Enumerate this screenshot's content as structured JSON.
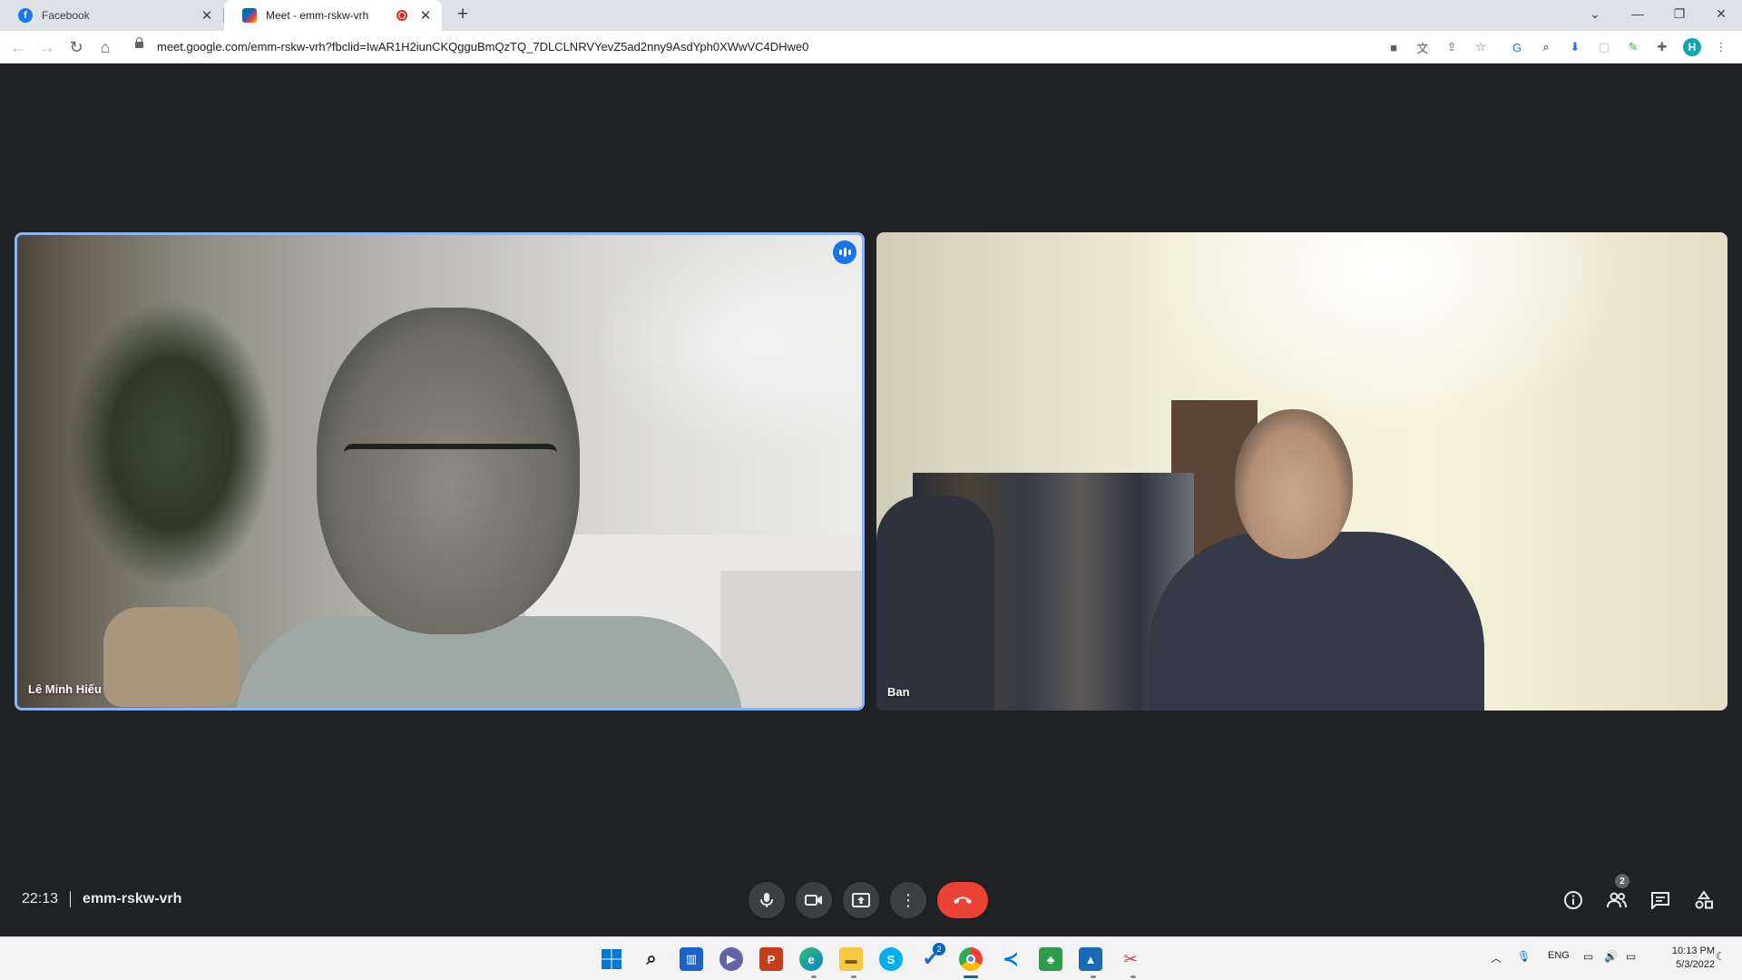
{
  "browser": {
    "tabs": [
      {
        "title": "Facebook",
        "icon": "facebook-icon",
        "active": false
      },
      {
        "title": "Meet - emm-rskw-vrh",
        "icon": "google-meet-icon",
        "active": true,
        "recording": true
      }
    ],
    "url": "meet.google.com/emm-rskw-vrh?fbclid=IwAR1H2iunCKQgguBmQzTQ_7DLCLNRVYevZ5ad2nny9AsdYph0XWwVC4DHwe0",
    "profile_initial": "H"
  },
  "meeting": {
    "time": "22:13",
    "code": "emm-rskw-vrh",
    "participants": [
      {
        "name": "Lê Minh Hiếu",
        "speaking": true
      },
      {
        "name": "Ban",
        "speaking": false
      }
    ],
    "people_count": "2"
  },
  "colors": {
    "meet_background": "#202124",
    "active_speaker_border": "#8ab4f8",
    "end_call": "#ea4335",
    "control_button": "#3c4043"
  },
  "taskbar": {
    "apps": [
      "windows-start-icon",
      "search-icon",
      "widgets-icon",
      "teams-chat-icon",
      "powerpoint-icon",
      "edge-icon",
      "file-explorer-icon",
      "skype-icon",
      "todo-icon",
      "chrome-icon",
      "vscode-icon",
      "app-icon",
      "photos-icon",
      "snipping-tool-icon"
    ],
    "todo_badge": "2",
    "language": "ENG",
    "clock_time": "10:13 PM",
    "clock_date": "5/3/2022"
  }
}
